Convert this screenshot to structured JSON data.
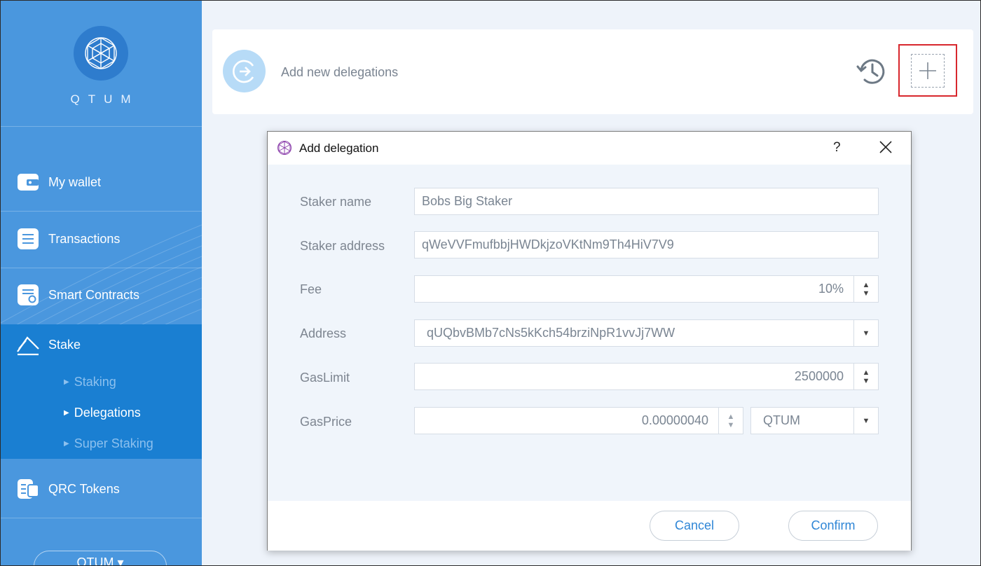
{
  "app": {
    "logo_text": "QTUM"
  },
  "sidebar": {
    "items": [
      {
        "label": "My wallet"
      },
      {
        "label": "Transactions"
      },
      {
        "label": "Smart Contracts"
      },
      {
        "label": "Stake"
      },
      {
        "label": "QRC Tokens"
      }
    ],
    "stake_sub": [
      {
        "label": "Staking"
      },
      {
        "label": "Delegations"
      },
      {
        "label": "Super Staking"
      }
    ],
    "currency": "QTUM ▾"
  },
  "header": {
    "title": "Add new delegations"
  },
  "dialog": {
    "title": "Add delegation",
    "help": "?",
    "fields": {
      "staker_name": {
        "label": "Staker name",
        "value": "Bobs Big Staker"
      },
      "staker_address": {
        "label": "Staker address",
        "value": "qWeVVFmufbbjHWDkjzoVKtNm9Th4HiV7V9"
      },
      "fee": {
        "label": "Fee",
        "value": "10%"
      },
      "address": {
        "label": "Address",
        "value": "qUQbvBMb7cNs5kKch54brziNpR1vvJj7WW"
      },
      "gas_limit": {
        "label": "GasLimit",
        "value": "2500000"
      },
      "gas_price": {
        "label": "GasPrice",
        "value": "0.00000040",
        "unit": "QTUM"
      }
    },
    "cancel_label": "Cancel",
    "confirm_label": "Confirm"
  },
  "colors": {
    "sidebar": "#4a97de",
    "sidebar_active": "#1a7fd2",
    "accent": "#2f86d6",
    "highlight": "#d8272d"
  }
}
